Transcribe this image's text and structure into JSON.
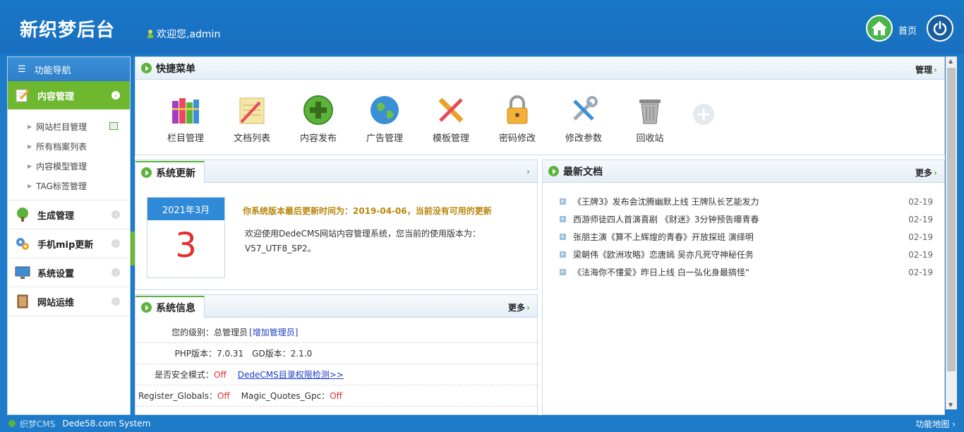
{
  "header": {
    "logo": "新织梦后台",
    "welcome": "欢迎您,admin",
    "home_label": "首页"
  },
  "sidebar": {
    "title": "功能导航",
    "active_section": "内容管理",
    "subitems": [
      "网站栏目管理",
      "所有档案列表",
      "内容模型管理",
      "TAG标签管理"
    ],
    "sections": [
      "生成管理",
      "手机mip更新",
      "系统设置",
      "网站运维"
    ]
  },
  "quick_menu": {
    "title": "快捷菜单",
    "manage": "管理",
    "items": [
      "栏目管理",
      "文档列表",
      "内容发布",
      "广告管理",
      "模板管理",
      "密码修改",
      "修改参数",
      "回收站"
    ]
  },
  "system_update": {
    "title": "系统更新",
    "calendar_month": "2021年3月",
    "calendar_day": "3",
    "headline": "你系统版本最后更新时间为：2019-04-06，当前没有可用的更新",
    "desc": "欢迎使用DedeCMS网站内容管理系统，您当前的使用版本为：V57_UTF8_SP2。"
  },
  "latest_docs": {
    "title": "最新文档",
    "more": "更多",
    "items": [
      {
        "title": "《王牌3》发布会沈腾幽默上线 王牌队长艺能发力",
        "date": "02-19"
      },
      {
        "title": "西游师徒四人首演喜剧 《财迷》3分钟预告曝青春",
        "date": "02-19"
      },
      {
        "title": "张朋主演《算不上辉煌的青春》开放探班 演绎明",
        "date": "02-19"
      },
      {
        "title": "梁朝伟《欧洲攻略》恋唐嫣 吴亦凡死守神秘任务",
        "date": "02-19"
      },
      {
        "title": "《法海你不懂爱》昨日上线 白一弘化身最搞怪“",
        "date": "02-19"
      }
    ]
  },
  "system_info": {
    "title": "系统信息",
    "more": "更多",
    "level_label": "您的级别：",
    "level_value": "总管理员",
    "add_admin": "[增加管理员]",
    "php_label": "PHP版本：",
    "php_value": "7.0.31",
    "gd_label": "GD版本：",
    "gd_value": "2.1.0",
    "safe_label": "是否安全模式：",
    "safe_value": "Off",
    "perm_link": "DedeCMS目录权限检测>>",
    "rg_label": "Register_Globals：",
    "rg_value": "Off",
    "mq_label": "Magic_Quotes_Gpc：",
    "mq_value": "Off"
  },
  "footer": {
    "brand": "织梦CMS",
    "system": "Dede58.com System",
    "sitemap": "功能地图"
  }
}
